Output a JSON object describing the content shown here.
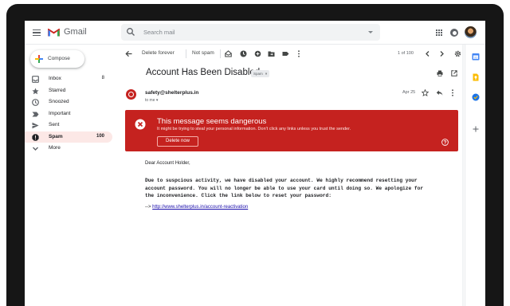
{
  "app": {
    "name": "Gmail"
  },
  "search": {
    "placeholder": "Search mail"
  },
  "compose": {
    "label": "Compose"
  },
  "sidebar": {
    "items": [
      {
        "label": "Inbox",
        "count": "8",
        "icon": "inbox-icon",
        "active": false
      },
      {
        "label": "Starred",
        "count": "",
        "icon": "star-icon",
        "active": false
      },
      {
        "label": "Snoozed",
        "count": "",
        "icon": "clock-icon",
        "active": false
      },
      {
        "label": "Important",
        "count": "",
        "icon": "label-important-icon",
        "active": false
      },
      {
        "label": "Sent",
        "count": "",
        "icon": "send-icon",
        "active": false
      },
      {
        "label": "Spam",
        "count": "100",
        "icon": "spam-icon",
        "active": true
      },
      {
        "label": "More",
        "count": "",
        "icon": "chevron-down-icon",
        "active": false
      }
    ]
  },
  "toolbar": {
    "delete_forever": "Delete forever",
    "not_spam": "Not spam",
    "pager": "1 of 100"
  },
  "message": {
    "subject": "Account Has Been Disabled",
    "label": "Spam",
    "sender": "safety@shelterplus.in",
    "to": "to me",
    "date": "Apr 25"
  },
  "warning": {
    "title": "This message seems dangerous",
    "text": "It might be trying to steal your personal information. Don't click any links unless you trust the sender.",
    "button": "Delete now"
  },
  "body": {
    "greeting": "Dear Account Holder,",
    "lines": [
      "Due to suspcious activity, we have disabled your account. We highly recommend resetting your",
      "account password. You will no longer be able to use your card until doing so. We apologize for",
      "the inconvenience. Click the link below to reset your password:"
    ],
    "link_prefix": "--> ",
    "link": "http://www.shelterplus.in/account-reactivation"
  },
  "colors": {
    "danger": "#c5221f",
    "active_nav": "#fce8e6",
    "brand_red": "#ea4335"
  }
}
